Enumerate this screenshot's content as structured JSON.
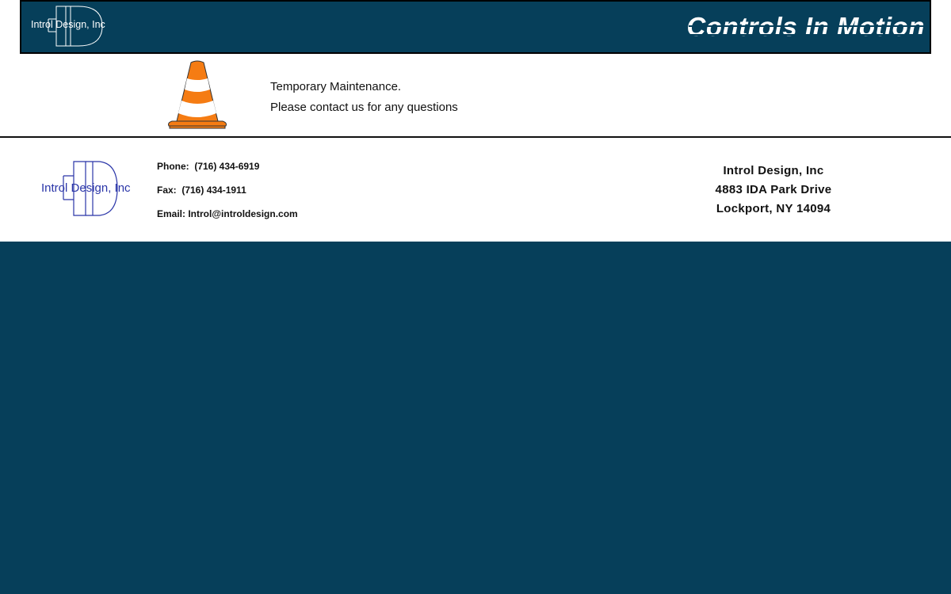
{
  "header": {
    "logo_text": "Introl Design, Inc",
    "tagline": "Controls In Motion"
  },
  "notice": {
    "line1": "Temporary Maintenance.",
    "line2": "Please contact us for any questions"
  },
  "icons": {
    "cone": "traffic-cone-icon",
    "logo_mark": "id-monogram-icon"
  },
  "footer": {
    "logo_text": "Introl Design, Inc",
    "phone": "Phone:  (716) 434-6919",
    "fax": "Fax:  (716) 434-1911",
    "email": "Email: Introl@introldesign.com",
    "address": {
      "company": "Introl Design, Inc",
      "street": "4883 IDA Park Drive",
      "city": "Lockport, NY 14094"
    }
  },
  "colors": {
    "brand_navy": "#063f5a",
    "cone_orange": "#f57c13",
    "logo_blue": "#2a35a8"
  }
}
